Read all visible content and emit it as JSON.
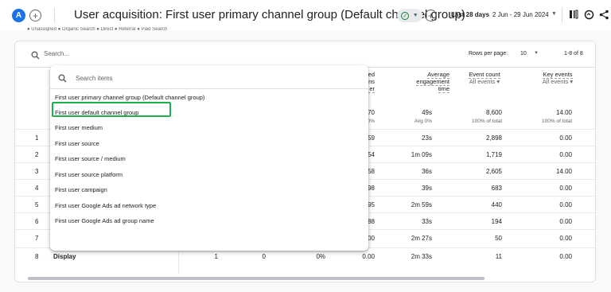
{
  "header": {
    "avatar_letter": "A",
    "title": "User acquisition: First user primary channel group (Default channel group)",
    "date_prefix": "Last 28 days",
    "date_range": "2 Jun - 29 Jun 2024"
  },
  "legend_strip": "● Unassigned  ● Organic Search  ● Direct  ● Referral  ● Paid Search",
  "table": {
    "search_placeholder": "Search...",
    "rows_per_page_label": "Rows per page:",
    "rows_per_page_value": "10",
    "range": "1-8 of 8",
    "columns": {
      "partial_col": [
        "ed",
        "ns",
        "er"
      ],
      "avg_engagement": [
        "Average",
        "engagement",
        "time"
      ],
      "event_count": "Event count",
      "event_count_sub": "All events",
      "key_events": "Key events",
      "key_events_sub": "All events"
    },
    "totals": {
      "partial": "70",
      "partial_sub": "0%",
      "avg_engagement": "49s",
      "avg_engagement_sub": "Avg 0%",
      "event_count": "8,600",
      "event_count_sub": "100% of total",
      "key_events": "14.00",
      "key_events_sub": "100% of total"
    },
    "rows": [
      {
        "idx": "1",
        "partial": "59",
        "avg": "23s",
        "events": "2,898",
        "key": "0.00"
      },
      {
        "idx": "2",
        "partial": "54",
        "avg": "1m 09s",
        "events": "1,719",
        "key": "0.00"
      },
      {
        "idx": "3",
        "partial": "58",
        "avg": "36s",
        "events": "2,605",
        "key": "14.00"
      },
      {
        "idx": "4",
        "partial": "98",
        "avg": "39s",
        "events": "683",
        "key": "0.00"
      },
      {
        "idx": "5",
        "partial": "95",
        "avg": "2m 59s",
        "events": "440",
        "key": "0.00"
      },
      {
        "idx": "6",
        "partial": "88",
        "avg": "33s",
        "events": "194",
        "key": "0.00"
      },
      {
        "idx": "7",
        "partial": "00",
        "avg": "2m 27s",
        "events": "50",
        "key": "0.00"
      },
      {
        "idx": "8",
        "name": "Display",
        "c1": "1",
        "c2": "0",
        "c3": "0%",
        "partial": "0.00",
        "avg": "2m 33s",
        "events": "11",
        "key": "0.00"
      }
    ]
  },
  "dropdown": {
    "search_placeholder": "Search items",
    "items": [
      "First user primary channel group (Default channel group)",
      "First user default channel group",
      "First user medium",
      "First user source",
      "First user source / medium",
      "First user source platform",
      "First user campaign",
      "First user Google Ads ad network type",
      "First user Google Ads ad group name"
    ],
    "highlighted_index": 1
  },
  "colors": {
    "accent": "#1a73e8",
    "highlight_border": "#1bb14c"
  }
}
